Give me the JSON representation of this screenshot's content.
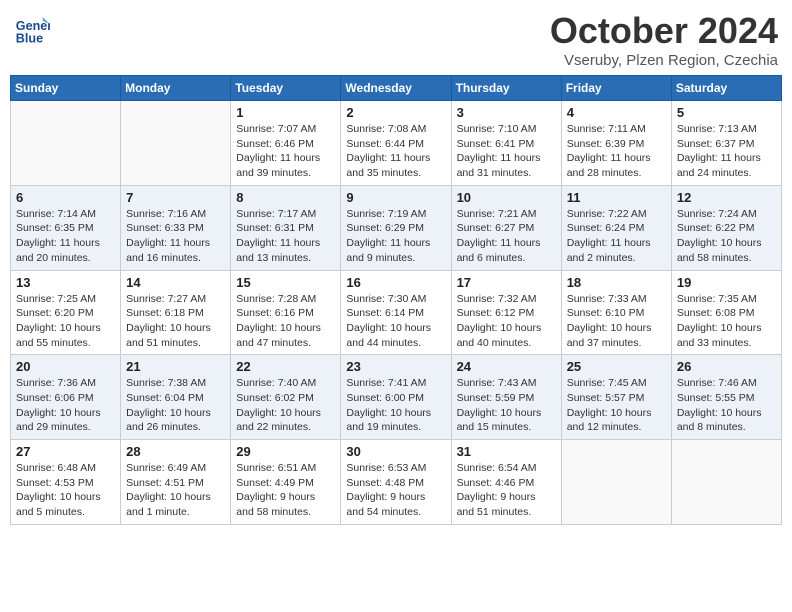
{
  "header": {
    "logo_line1": "General",
    "logo_line2": "Blue",
    "month": "October 2024",
    "location": "Vseruby, Plzen Region, Czechia"
  },
  "weekdays": [
    "Sunday",
    "Monday",
    "Tuesday",
    "Wednesday",
    "Thursday",
    "Friday",
    "Saturday"
  ],
  "weeks": [
    [
      {
        "day": "",
        "info": ""
      },
      {
        "day": "",
        "info": ""
      },
      {
        "day": "1",
        "info": "Sunrise: 7:07 AM\nSunset: 6:46 PM\nDaylight: 11 hours and 39 minutes."
      },
      {
        "day": "2",
        "info": "Sunrise: 7:08 AM\nSunset: 6:44 PM\nDaylight: 11 hours and 35 minutes."
      },
      {
        "day": "3",
        "info": "Sunrise: 7:10 AM\nSunset: 6:41 PM\nDaylight: 11 hours and 31 minutes."
      },
      {
        "day": "4",
        "info": "Sunrise: 7:11 AM\nSunset: 6:39 PM\nDaylight: 11 hours and 28 minutes."
      },
      {
        "day": "5",
        "info": "Sunrise: 7:13 AM\nSunset: 6:37 PM\nDaylight: 11 hours and 24 minutes."
      }
    ],
    [
      {
        "day": "6",
        "info": "Sunrise: 7:14 AM\nSunset: 6:35 PM\nDaylight: 11 hours and 20 minutes."
      },
      {
        "day": "7",
        "info": "Sunrise: 7:16 AM\nSunset: 6:33 PM\nDaylight: 11 hours and 16 minutes."
      },
      {
        "day": "8",
        "info": "Sunrise: 7:17 AM\nSunset: 6:31 PM\nDaylight: 11 hours and 13 minutes."
      },
      {
        "day": "9",
        "info": "Sunrise: 7:19 AM\nSunset: 6:29 PM\nDaylight: 11 hours and 9 minutes."
      },
      {
        "day": "10",
        "info": "Sunrise: 7:21 AM\nSunset: 6:27 PM\nDaylight: 11 hours and 6 minutes."
      },
      {
        "day": "11",
        "info": "Sunrise: 7:22 AM\nSunset: 6:24 PM\nDaylight: 11 hours and 2 minutes."
      },
      {
        "day": "12",
        "info": "Sunrise: 7:24 AM\nSunset: 6:22 PM\nDaylight: 10 hours and 58 minutes."
      }
    ],
    [
      {
        "day": "13",
        "info": "Sunrise: 7:25 AM\nSunset: 6:20 PM\nDaylight: 10 hours and 55 minutes."
      },
      {
        "day": "14",
        "info": "Sunrise: 7:27 AM\nSunset: 6:18 PM\nDaylight: 10 hours and 51 minutes."
      },
      {
        "day": "15",
        "info": "Sunrise: 7:28 AM\nSunset: 6:16 PM\nDaylight: 10 hours and 47 minutes."
      },
      {
        "day": "16",
        "info": "Sunrise: 7:30 AM\nSunset: 6:14 PM\nDaylight: 10 hours and 44 minutes."
      },
      {
        "day": "17",
        "info": "Sunrise: 7:32 AM\nSunset: 6:12 PM\nDaylight: 10 hours and 40 minutes."
      },
      {
        "day": "18",
        "info": "Sunrise: 7:33 AM\nSunset: 6:10 PM\nDaylight: 10 hours and 37 minutes."
      },
      {
        "day": "19",
        "info": "Sunrise: 7:35 AM\nSunset: 6:08 PM\nDaylight: 10 hours and 33 minutes."
      }
    ],
    [
      {
        "day": "20",
        "info": "Sunrise: 7:36 AM\nSunset: 6:06 PM\nDaylight: 10 hours and 29 minutes."
      },
      {
        "day": "21",
        "info": "Sunrise: 7:38 AM\nSunset: 6:04 PM\nDaylight: 10 hours and 26 minutes."
      },
      {
        "day": "22",
        "info": "Sunrise: 7:40 AM\nSunset: 6:02 PM\nDaylight: 10 hours and 22 minutes."
      },
      {
        "day": "23",
        "info": "Sunrise: 7:41 AM\nSunset: 6:00 PM\nDaylight: 10 hours and 19 minutes."
      },
      {
        "day": "24",
        "info": "Sunrise: 7:43 AM\nSunset: 5:59 PM\nDaylight: 10 hours and 15 minutes."
      },
      {
        "day": "25",
        "info": "Sunrise: 7:45 AM\nSunset: 5:57 PM\nDaylight: 10 hours and 12 minutes."
      },
      {
        "day": "26",
        "info": "Sunrise: 7:46 AM\nSunset: 5:55 PM\nDaylight: 10 hours and 8 minutes."
      }
    ],
    [
      {
        "day": "27",
        "info": "Sunrise: 6:48 AM\nSunset: 4:53 PM\nDaylight: 10 hours and 5 minutes."
      },
      {
        "day": "28",
        "info": "Sunrise: 6:49 AM\nSunset: 4:51 PM\nDaylight: 10 hours and 1 minute."
      },
      {
        "day": "29",
        "info": "Sunrise: 6:51 AM\nSunset: 4:49 PM\nDaylight: 9 hours and 58 minutes."
      },
      {
        "day": "30",
        "info": "Sunrise: 6:53 AM\nSunset: 4:48 PM\nDaylight: 9 hours and 54 minutes."
      },
      {
        "day": "31",
        "info": "Sunrise: 6:54 AM\nSunset: 4:46 PM\nDaylight: 9 hours and 51 minutes."
      },
      {
        "day": "",
        "info": ""
      },
      {
        "day": "",
        "info": ""
      }
    ]
  ]
}
